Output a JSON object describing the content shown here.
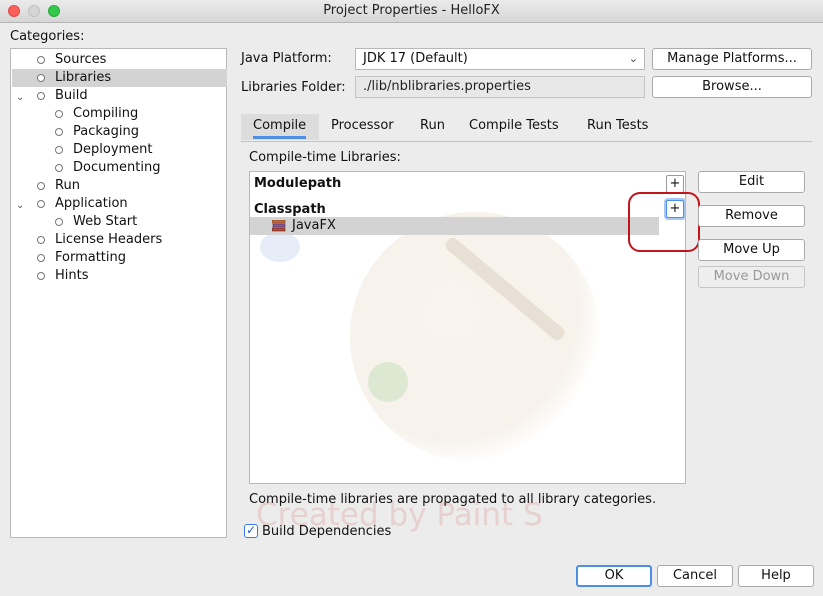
{
  "window": {
    "title": "Project Properties - HelloFX"
  },
  "categories": {
    "label": "Categories:",
    "items": [
      {
        "label": "Sources"
      },
      {
        "label": "Libraries"
      },
      {
        "label": "Build"
      },
      {
        "label": "Compiling"
      },
      {
        "label": "Packaging"
      },
      {
        "label": "Deployment"
      },
      {
        "label": "Documenting"
      },
      {
        "label": "Run"
      },
      {
        "label": "Application"
      },
      {
        "label": "Web Start"
      },
      {
        "label": "License Headers"
      },
      {
        "label": "Formatting"
      },
      {
        "label": "Hints"
      }
    ],
    "selected": "Libraries"
  },
  "platform": {
    "label": "Java Platform:",
    "value": "JDK 17 (Default)",
    "manage_button": "Manage Platforms..."
  },
  "libraries_folder": {
    "label": "Libraries Folder:",
    "value": "./lib/nblibraries.properties",
    "browse_button": "Browse..."
  },
  "tabs": [
    {
      "label": "Compile",
      "active": true
    },
    {
      "label": "Processor"
    },
    {
      "label": "Run"
    },
    {
      "label": "Compile Tests"
    },
    {
      "label": "Run Tests"
    }
  ],
  "compile_libs": {
    "label": "Compile-time Libraries:",
    "modulepath_label": "Modulepath",
    "classpath_label": "Classpath",
    "add_symbol": "+",
    "classpath_items": [
      {
        "label": "JavaFX"
      }
    ],
    "note": "Compile-time libraries are propagated to all library categories."
  },
  "side_buttons": {
    "edit": "Edit",
    "remove": "Remove",
    "move_up": "Move Up",
    "move_down": "Move Down"
  },
  "build_dependencies": {
    "label": "Build Dependencies",
    "checked": true,
    "check_glyph": "✓"
  },
  "watermark": "Created by Paint S",
  "footer": {
    "ok": "OK",
    "cancel": "Cancel",
    "help": "Help"
  },
  "colors": {
    "accent": "#4d8fe7",
    "callout": "#c0151b",
    "selection": "#d3d3d3"
  }
}
